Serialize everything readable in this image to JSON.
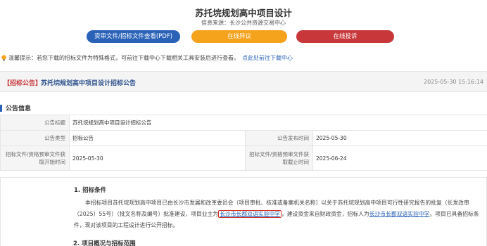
{
  "page": {
    "title": "苏托垸规划高中项目设计",
    "source": "信息来源：长沙公共资源交易中心"
  },
  "buttons": {
    "doc_view": "资审文件/招标文件查看(PDF)",
    "objection": "在线异议",
    "complaint": "在线投诉"
  },
  "colors": {
    "primary": "#2a62b8",
    "objection": "#f5a21d",
    "complaint": "#c8383b",
    "highlight_box": "#d93025"
  },
  "notice": {
    "icon": "lightbulb-icon",
    "text": "温馨提示：若您下载的招标文件为特殊格式，可前往下载中心下载相关工具安装后进行查看。",
    "link": "点此处前往下载中心"
  },
  "announcement": {
    "tag": "【招标公告】",
    "headline": "苏托垸规划高中项目设计招标公告",
    "datetime": "2025-05-30 15:16:14"
  },
  "info": {
    "section_title": "公告信息",
    "labels": {
      "title": "公告标题",
      "type": "公告类型",
      "publish_time": "公告发布时间",
      "start": "招标文件/资格预审文件获取开始时间",
      "end": "招标文件/资格预审文件获取截止时间"
    },
    "values": {
      "title": "苏托垸规划高中项目设计招标公告",
      "type": "招标公告",
      "publish_time": "2025-05-30",
      "start": "2025-05-30",
      "end": "2025-06-24"
    }
  },
  "body": {
    "h1": "1. 招标条件",
    "p1": "本招标项目苏托垸规划高中项目已由长沙市发展和改革委员会（项目审批、核准或备案机关名称）以关于苏托垸规划高中项目可行性研究报告的批复（长发改审（2025）55号）（批文名称及编号）批准建设，项目业主为",
    "owner": "长沙市长郡双语实验中学",
    "p2": "，建设资金来自财政资金，招标人为",
    "tenderer": "长沙市长郡双语实验中学",
    "p3": "。项目已具备招标条件，现对该项目的工程设计进行公开招标。",
    "h2": "2. 项目概况与招标范围"
  }
}
